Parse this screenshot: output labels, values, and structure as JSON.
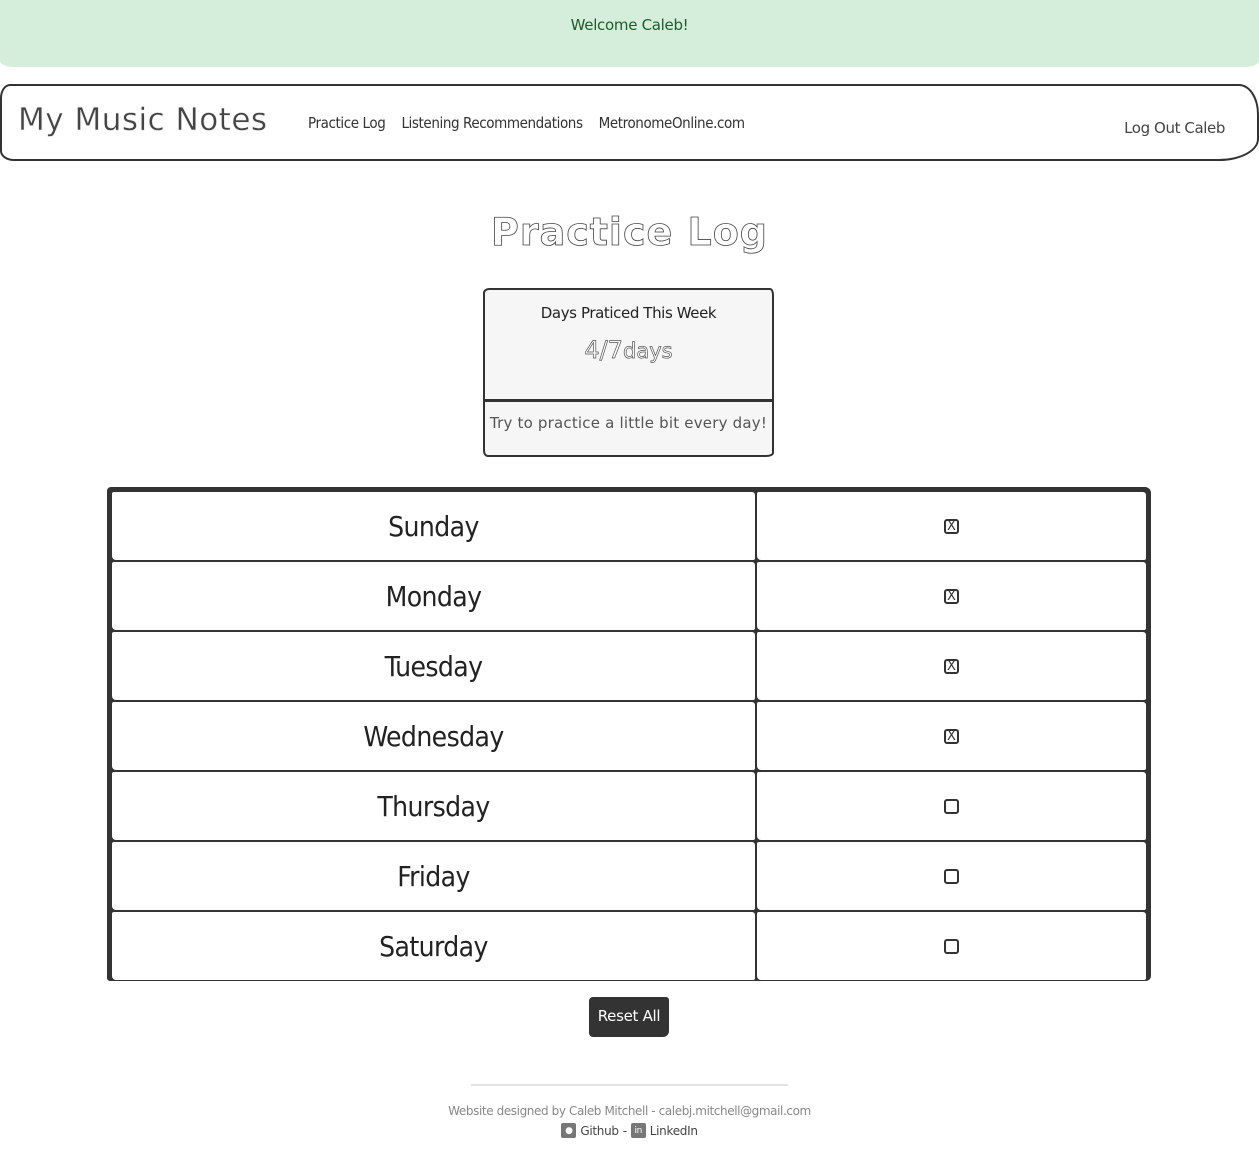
{
  "alert": {
    "text": "Welcome Caleb!"
  },
  "navbar": {
    "brand": "My Music Notes",
    "links": [
      "Practice Log",
      "Listening Recommendations",
      "MetronomeOnline.com"
    ],
    "logout": "Log Out Caleb"
  },
  "page": {
    "title": "Practice Log"
  },
  "card": {
    "heading": "Days Praticed This Week",
    "count": "4/7",
    "unit": "days",
    "footer": "Try to practice a little bit every day!"
  },
  "days": [
    {
      "name": "Sunday",
      "checked": true
    },
    {
      "name": "Monday",
      "checked": true
    },
    {
      "name": "Tuesday",
      "checked": true
    },
    {
      "name": "Wednesday",
      "checked": true
    },
    {
      "name": "Thursday",
      "checked": false
    },
    {
      "name": "Friday",
      "checked": false
    },
    {
      "name": "Saturday",
      "checked": false
    }
  ],
  "reset_label": "Reset All",
  "footer": {
    "credit": "Website designed by Caleb Mitchell - calebj.mitchell@gmail.com",
    "github": "Github",
    "separator": "-",
    "linkedin": "LinkedIn",
    "github_icon": "github-icon",
    "linkedin_icon": "linkedin-icon"
  }
}
